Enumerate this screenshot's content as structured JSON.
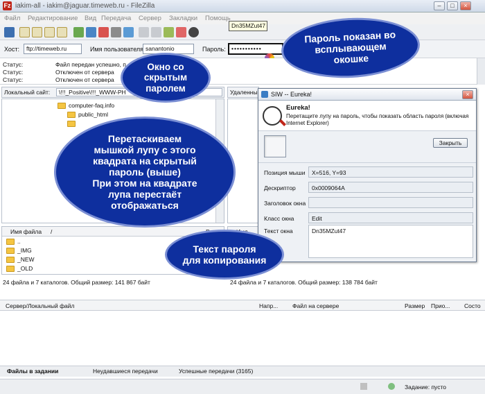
{
  "app": {
    "title": "iakim-all - iakim@jaguar.timeweb.ru - FileZilla"
  },
  "menu": [
    "Файл",
    "Редактирование",
    "Вид",
    "Передача",
    "Сервер",
    "Закладки",
    "Помощь"
  ],
  "quickconnect": {
    "host_label": "Хост:",
    "host_value": "ftp://timeweb.ru",
    "user_label": "Имя пользователя",
    "user_value": "sanantonio",
    "pass_label": "Пароль:",
    "pass_value": "•••••••••••",
    "port_label": "П"
  },
  "tooltip": "Dn35MZut47",
  "log": [
    {
      "label": "Статус:",
      "text": "Файл передан успешно, п"
    },
    {
      "label": "Статус:",
      "text": "Отключен от сервера"
    },
    {
      "label": "Статус:",
      "text": "Отключен от сервера"
    }
  ],
  "local": {
    "site_label": "Локальный сайт:",
    "site_path": "\\!!!_Positive\\!!!_WWW-PH",
    "tree": [
      "computer-faq.info",
      "public_html"
    ],
    "col_name": "Имя файла",
    "col_sort": "/",
    "col_size": "Раз",
    "files": [
      "..",
      "_IMG",
      "_NEW",
      "_OLD"
    ],
    "status": "24 файла и 7 каталогов. Общий размер: 141 867 байт"
  },
  "remote": {
    "site_label": "Удаленны",
    "col_name": "Имя",
    "status": "24 файла и 7 каталогов. Общий размер: 138 784 байт"
  },
  "queue": {
    "columns": [
      "Сервер/Локальный файл",
      "Напр...",
      "Файл на сервере",
      "Размер",
      "Прио...",
      "Состо"
    ]
  },
  "tabs": [
    "Файлы в задании",
    "Неудавшиеся передачи",
    "Успешные передачи (3165)"
  ],
  "statusbar": {
    "queue": "Задание: пусто"
  },
  "eureka": {
    "title": "SIW -- Eureka!",
    "heading": "Eureka!",
    "description": "Перетащите лупу на пароль, чтобы показать область пароля (включая Internet Explorer)",
    "close_button": "Закрыть",
    "fields": [
      {
        "label": "Позиция мыши",
        "value": "X=516, Y=93"
      },
      {
        "label": "Дескриптор",
        "value": "0x0009064A"
      },
      {
        "label": "Заголовок окна",
        "value": ""
      },
      {
        "label": "Класс окна",
        "value": "Edit"
      },
      {
        "label": "Текст окна",
        "value": "Dn35MZut47"
      }
    ]
  },
  "callouts": {
    "password_popup": "Пароль показан во\nвсплывающем\nокошке",
    "hidden_window": "Окно со\nскрытым\nпаролем",
    "drag_magnifier": "Перетаскиваем\nмышкой лупу с этого\nквадрата на скрытый\nпароль (выше)\nПри этом на квадрате\nлупа перестаёт\nотображаться",
    "password_text": "Текст пароля\nдля копирования"
  },
  "colors": {
    "callout_bg": "#0e2f9e",
    "tooltip_bg": "#ffffe1",
    "folder": "#f5c542"
  }
}
